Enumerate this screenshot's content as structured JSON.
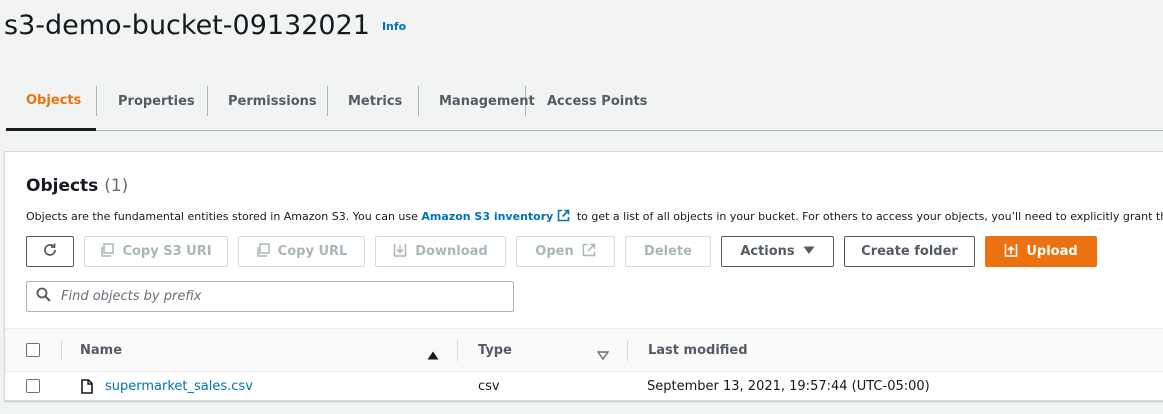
{
  "header": {
    "bucket_name": "s3-demo-bucket-09132021",
    "info_label": "Info"
  },
  "tabs": [
    {
      "label": "Objects",
      "active": true
    },
    {
      "label": "Properties",
      "active": false
    },
    {
      "label": "Permissions",
      "active": false
    },
    {
      "label": "Metrics",
      "active": false
    },
    {
      "label": "Management",
      "active": false
    },
    {
      "label": "Access Points",
      "active": false
    }
  ],
  "objects_panel": {
    "title": "Objects",
    "count": "(1)",
    "description_prefix": "Objects are the fundamental entities stored in Amazon S3. You can use",
    "description_link": "Amazon S3 inventory",
    "description_suffix": "to get a list of all objects in your bucket. For others to access your objects, you’ll need to explicitly grant them p"
  },
  "toolbar": {
    "refresh_icon": "refresh-icon",
    "copy_s3_uri": "Copy S3 URI",
    "copy_url": "Copy URL",
    "download": "Download",
    "open": "Open",
    "delete": "Delete",
    "actions": "Actions",
    "create_folder": "Create folder",
    "upload": "Upload"
  },
  "search": {
    "placeholder": "Find objects by prefix",
    "value": ""
  },
  "table": {
    "columns": [
      {
        "label": "Name",
        "sort": "ascending"
      },
      {
        "label": "Type",
        "sort": "none"
      },
      {
        "label": "Last modified",
        "sort": "none"
      }
    ],
    "rows": [
      {
        "name": "supermarket_sales.csv",
        "type": "csv",
        "last_modified": "September 13, 2021, 19:57:44 (UTC-05:00)"
      }
    ]
  },
  "colors": {
    "accent_orange": "#ec7211",
    "link_blue": "#0073bb",
    "text_dark": "#16191f",
    "text_muted": "#545b64",
    "disabled": "#aab7b8"
  }
}
